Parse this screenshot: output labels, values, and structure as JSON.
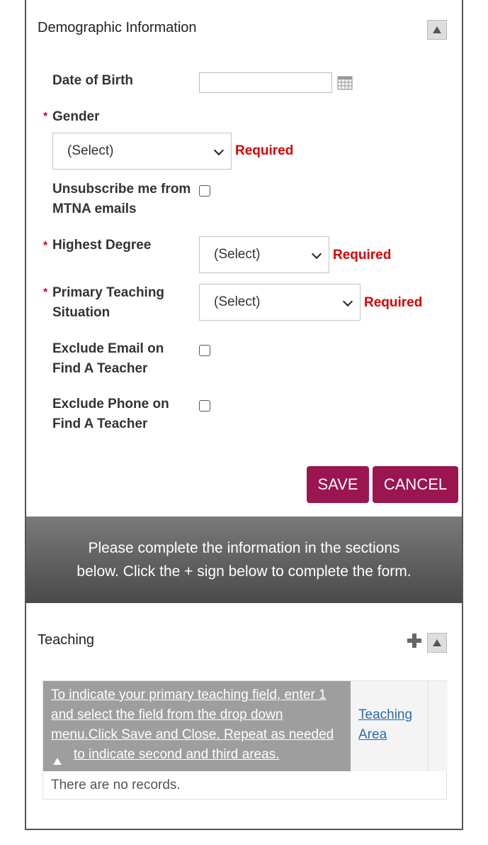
{
  "demographic": {
    "title": "Demographic Information",
    "fields": {
      "dob_label": "Date of Birth",
      "dob_value": "",
      "gender_label": "Gender",
      "gender_value": "(Select)",
      "unsubscribe_label_line1": "Unsubscribe me from",
      "unsubscribe_label_line2": "MTNA emails",
      "degree_label": "Highest Degree",
      "degree_value": "(Select)",
      "teaching_label_line1": "Primary Teaching",
      "teaching_label_line2": "Situation",
      "teaching_value": "(Select)",
      "exclude_email_line1": "Exclude Email on",
      "exclude_email_line2": "Find A Teacher",
      "exclude_phone_line1": "Exclude Phone on",
      "exclude_phone_line2": "Find A Teacher"
    },
    "required_star": "*",
    "required_text": "Required",
    "save_label": "SAVE",
    "cancel_label": "CANCEL"
  },
  "banner": {
    "line1": "Please complete the information in the sections",
    "line2": "below.  Click the + sign below to complete the form."
  },
  "teaching": {
    "title": "Teaching",
    "table": {
      "col1_lines": [
        "To indicate your primary teaching field, enter 1",
        "and select the field from the drop down",
        "menu.Click Save and Close. Repeat as needed",
        "to indicate second and third areas."
      ],
      "col2_lines": [
        "Teaching",
        "Area"
      ],
      "empty_text": "There are no records."
    }
  },
  "icons": {
    "collapse": "triangle-up-icon",
    "calendar": "calendar-icon",
    "add": "plus-icon"
  },
  "colors": {
    "accent": "#9b1550",
    "required": "#d90000",
    "banner": "#5d5d5d"
  }
}
